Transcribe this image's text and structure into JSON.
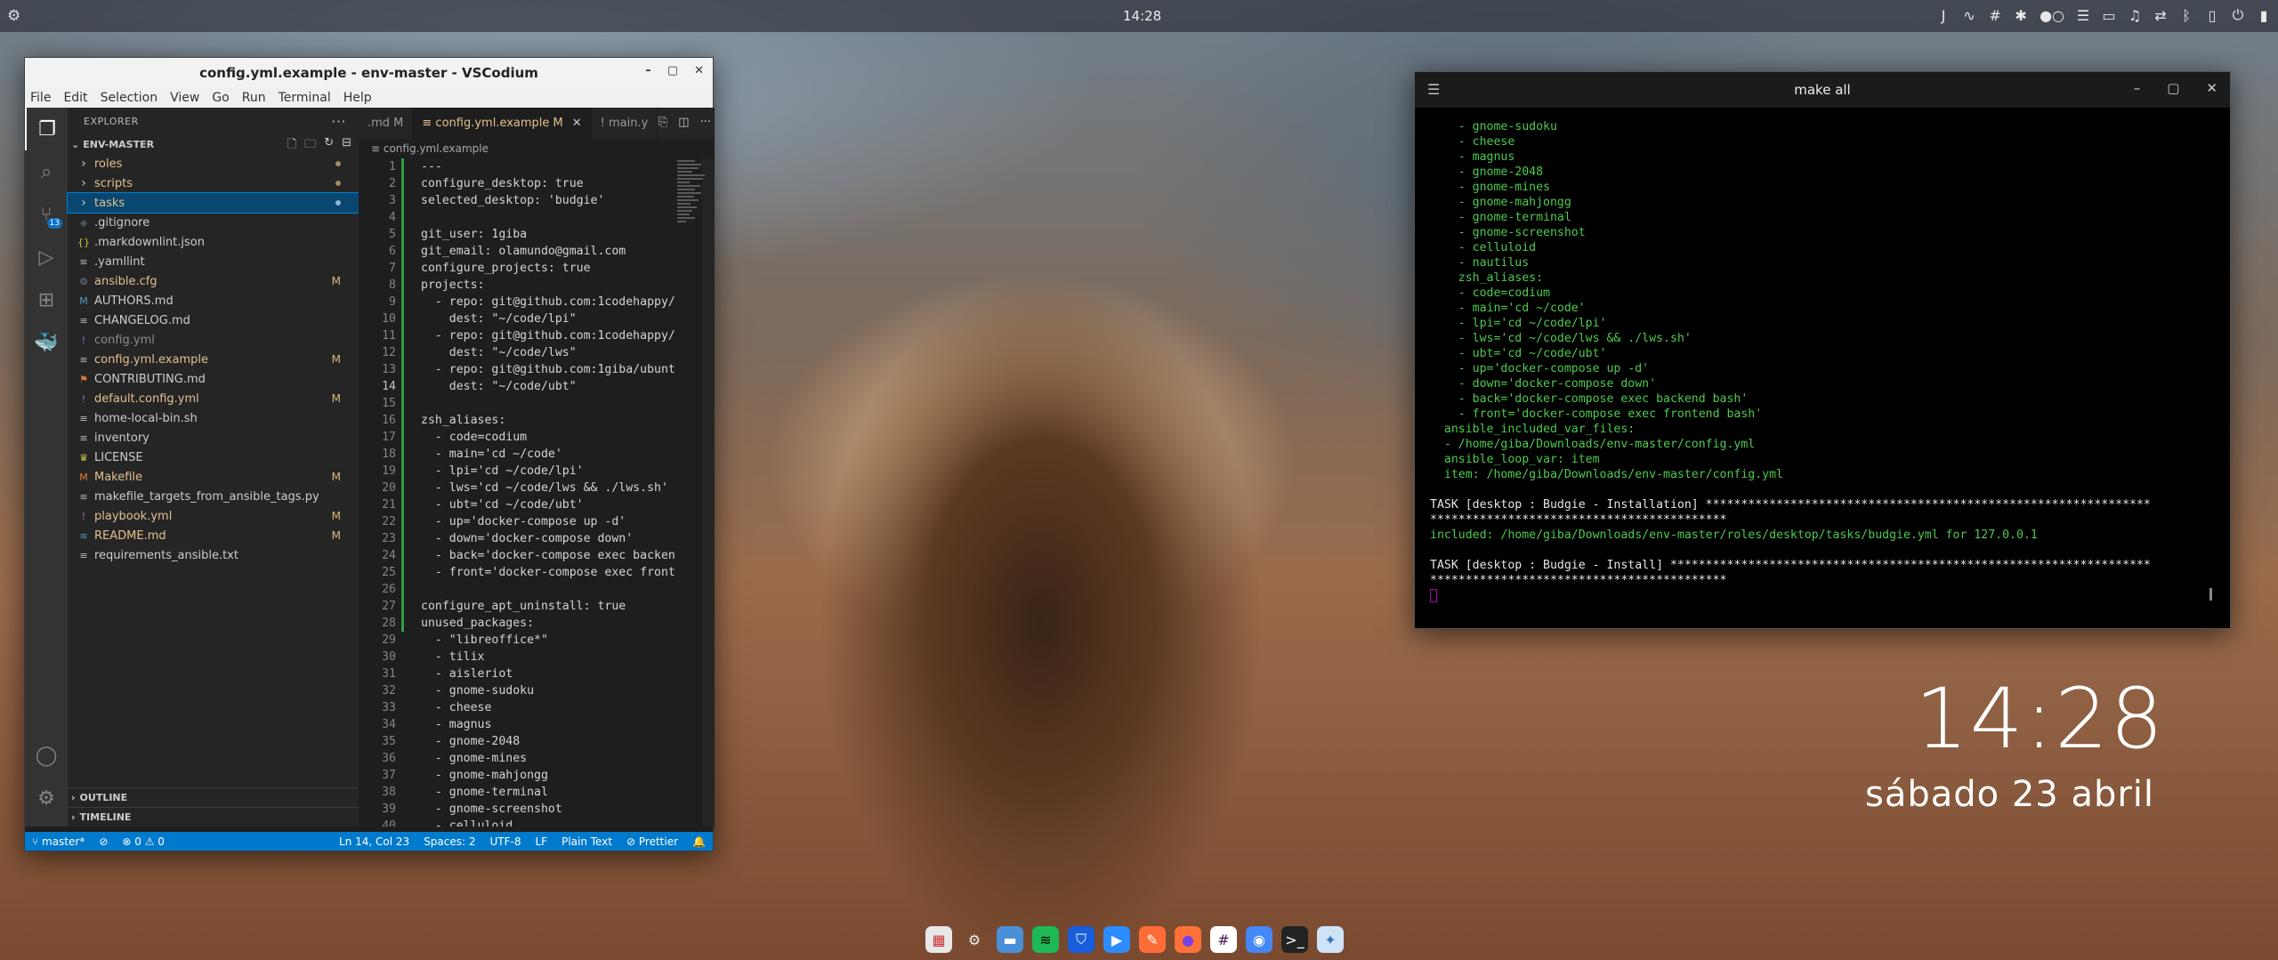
{
  "topbar": {
    "clock": "14:28"
  },
  "vscode": {
    "title": "config.yml.example - env-master - VSCodium",
    "menu": [
      "File",
      "Edit",
      "Selection",
      "View",
      "Go",
      "Run",
      "Terminal",
      "Help"
    ],
    "explorer_header": "EXPLORER",
    "root": "ENV-MASTER",
    "tree": [
      {
        "name": "roles",
        "kind": "dir",
        "mark": "dot"
      },
      {
        "name": "scripts",
        "kind": "dir",
        "mark": "dot"
      },
      {
        "name": "tasks",
        "kind": "dir",
        "mark": "dot",
        "selected": true
      },
      {
        "name": ".gitignore",
        "kind": "file",
        "icon": "◆",
        "iconColor": "#41535b",
        "cls": "c-norm"
      },
      {
        "name": ".markdownlint.json",
        "kind": "file",
        "icon": "{}",
        "iconColor": "#cbcb41",
        "cls": "c-norm"
      },
      {
        "name": ".yamllint",
        "kind": "file",
        "icon": "≡",
        "iconColor": "#bbb",
        "cls": "c-norm"
      },
      {
        "name": "ansible.cfg",
        "kind": "file",
        "icon": "⚙",
        "iconColor": "#6d8086",
        "cls": "c-mod",
        "mark": "M"
      },
      {
        "name": "AUTHORS.md",
        "kind": "file",
        "icon": "M",
        "iconColor": "#519aba",
        "cls": "c-norm"
      },
      {
        "name": "CHANGELOG.md",
        "kind": "file",
        "icon": "≡",
        "iconColor": "#bbb",
        "cls": "c-norm"
      },
      {
        "name": "config.yml",
        "kind": "file",
        "icon": "!",
        "iconColor": "#a074c4",
        "cls": "c-dim"
      },
      {
        "name": "config.yml.example",
        "kind": "file",
        "icon": "≡",
        "iconColor": "#bbb",
        "cls": "c-mod",
        "mark": "M"
      },
      {
        "name": "CONTRIBUTING.md",
        "kind": "file",
        "icon": "⚑",
        "iconColor": "#e37933",
        "cls": "c-norm"
      },
      {
        "name": "default.config.yml",
        "kind": "file",
        "icon": "!",
        "iconColor": "#a074c4",
        "cls": "c-mod",
        "mark": "M"
      },
      {
        "name": "home-local-bin.sh",
        "kind": "file",
        "icon": "≡",
        "iconColor": "#bbb",
        "cls": "c-norm"
      },
      {
        "name": "inventory",
        "kind": "file",
        "icon": "≡",
        "iconColor": "#bbb",
        "cls": "c-norm"
      },
      {
        "name": "LICENSE",
        "kind": "file",
        "icon": "♛",
        "iconColor": "#cbcb41",
        "cls": "c-norm"
      },
      {
        "name": "Makefile",
        "kind": "file",
        "icon": "M",
        "iconColor": "#e37933",
        "cls": "c-mod",
        "mark": "M"
      },
      {
        "name": "makefile_targets_from_ansible_tags.py",
        "kind": "file",
        "icon": "≡",
        "iconColor": "#bbb",
        "cls": "c-norm"
      },
      {
        "name": "playbook.yml",
        "kind": "file",
        "icon": "!",
        "iconColor": "#a074c4",
        "cls": "c-mod",
        "mark": "M"
      },
      {
        "name": "README.md",
        "kind": "file",
        "icon": "≡",
        "iconColor": "#519aba",
        "cls": "c-mod",
        "mark": "M"
      },
      {
        "name": "requirements_ansible.txt",
        "kind": "file",
        "icon": "≡",
        "iconColor": "#bbb",
        "cls": "c-norm"
      }
    ],
    "outline": "OUTLINE",
    "timeline": "TIMELINE",
    "tabs": [
      {
        "label": ".md  M",
        "active": false
      },
      {
        "label": "≡ config.yml.example  M",
        "active": true
      },
      {
        "label": "! main.y",
        "active": false
      }
    ],
    "breadcrumb": "≡ config.yml.example",
    "code": [
      "---",
      "configure_desktop: true",
      "selected_desktop: 'budgie'",
      "",
      "git_user: 1giba",
      "git_email: olamundo@gmail.com",
      "configure_projects: true",
      "projects:",
      "  - repo: git@github.com:1codehappy/",
      "    dest: \"~/code/lpi\"",
      "  - repo: git@github.com:1codehappy/",
      "    dest: \"~/code/lws\"",
      "  - repo: git@github.com:1giba/ubunt",
      "    dest: \"~/code/ubt\"",
      "",
      "zsh_aliases:",
      "  - code=codium",
      "  - main='cd ~/code'",
      "  - lpi='cd ~/code/lpi'",
      "  - lws='cd ~/code/lws && ./lws.sh'",
      "  - ubt='cd ~/code/ubt'",
      "  - up='docker-compose up -d'",
      "  - down='docker-compose down'",
      "  - back='docker-compose exec backen",
      "  - front='docker-compose exec front",
      "",
      "configure_apt_uninstall: true",
      "unused_packages:",
      "  - \"libreoffice*\"",
      "  - tilix",
      "  - aisleriot",
      "  - gnome-sudoku",
      "  - cheese",
      "  - magnus",
      "  - gnome-2048",
      "  - gnome-mines",
      "  - gnome-mahjongg",
      "  - gnome-terminal",
      "  - gnome-screenshot",
      "  - celluloid"
    ],
    "current_line": 14,
    "status": {
      "branch": "master*",
      "sync": "⊘",
      "problems": "⊗ 0 ⚠ 0",
      "position": "Ln 14, Col 23",
      "spaces": "Spaces: 2",
      "encoding": "UTF-8",
      "eol": "LF",
      "language": "Plain Text",
      "formatter": "⊘ Prettier",
      "bell": "🔔"
    }
  },
  "terminal": {
    "title": "make all",
    "lines": [
      {
        "t": "    - gnome-sudoku",
        "c": "g"
      },
      {
        "t": "    - cheese",
        "c": "g"
      },
      {
        "t": "    - magnus",
        "c": "g"
      },
      {
        "t": "    - gnome-2048",
        "c": "g"
      },
      {
        "t": "    - gnome-mines",
        "c": "g"
      },
      {
        "t": "    - gnome-mahjongg",
        "c": "g"
      },
      {
        "t": "    - gnome-terminal",
        "c": "g"
      },
      {
        "t": "    - gnome-screenshot",
        "c": "g"
      },
      {
        "t": "    - celluloid",
        "c": "g"
      },
      {
        "t": "    - nautilus",
        "c": "g"
      },
      {
        "t": "    zsh_aliases:",
        "c": "g"
      },
      {
        "t": "    - code=codium",
        "c": "g"
      },
      {
        "t": "    - main='cd ~/code'",
        "c": "g"
      },
      {
        "t": "    - lpi='cd ~/code/lpi'",
        "c": "g"
      },
      {
        "t": "    - lws='cd ~/code/lws && ./lws.sh'",
        "c": "g"
      },
      {
        "t": "    - ubt='cd ~/code/ubt'",
        "c": "g"
      },
      {
        "t": "    - up='docker-compose up -d'",
        "c": "g"
      },
      {
        "t": "    - down='docker-compose down'",
        "c": "g"
      },
      {
        "t": "    - back='docker-compose exec backend bash'",
        "c": "g"
      },
      {
        "t": "    - front='docker-compose exec frontend bash'",
        "c": "g"
      },
      {
        "t": "  ansible_included_var_files:",
        "c": "g"
      },
      {
        "t": "  - /home/giba/Downloads/env-master/config.yml",
        "c": "g"
      },
      {
        "t": "  ansible_loop_var: item",
        "c": "g"
      },
      {
        "t": "  item: /home/giba/Downloads/env-master/config.yml",
        "c": "g"
      },
      {
        "t": "",
        "c": "w"
      },
      {
        "t": "TASK [desktop : Budgie - Installation] ***************************************************************",
        "c": "w"
      },
      {
        "t": "******************************************",
        "c": "w"
      },
      {
        "t": "included: /home/giba/Downloads/env-master/roles/desktop/tasks/budgie.yml for 127.0.0.1",
        "c": "g"
      },
      {
        "t": "",
        "c": "w"
      },
      {
        "t": "TASK [desktop : Budgie - Install] ********************************************************************",
        "c": "w"
      },
      {
        "t": "******************************************",
        "c": "w"
      }
    ]
  },
  "lockclock": {
    "time": "14:28",
    "date": "sábado 23 abril"
  },
  "dock": [
    {
      "name": "calendar-app-icon",
      "bg": "#e8e8e8",
      "g": "▦",
      "c": "#c33"
    },
    {
      "name": "settings-app-icon",
      "bg": "transparent",
      "g": "⚙",
      "c": "#eee"
    },
    {
      "name": "files-app-icon",
      "bg": "#4a90d9",
      "g": "▬",
      "c": "#fff"
    },
    {
      "name": "spotify-app-icon",
      "bg": "#1db954",
      "g": "≋",
      "c": "#000"
    },
    {
      "name": "bitwarden-app-icon",
      "bg": "#175ddc",
      "g": "⛉",
      "c": "#fff"
    },
    {
      "name": "zoom-app-icon",
      "bg": "#2d8cff",
      "g": "▶",
      "c": "#fff"
    },
    {
      "name": "postman-app-icon",
      "bg": "#ff6c37",
      "g": "✎",
      "c": "#fff"
    },
    {
      "name": "firefox-app-icon",
      "bg": "#ff7139",
      "g": "●",
      "c": "#7542e5"
    },
    {
      "name": "slack-app-icon",
      "bg": "#ffffff",
      "g": "#",
      "c": "#4a154b"
    },
    {
      "name": "chromium-app-icon",
      "bg": "#4587f4",
      "g": "◉",
      "c": "#fff"
    },
    {
      "name": "terminal-app-icon",
      "bg": "#222",
      "g": ">_",
      "c": "#fff"
    },
    {
      "name": "budgie-settings-app-icon",
      "bg": "#cfe3f7",
      "g": "✦",
      "c": "#3473b8"
    }
  ]
}
